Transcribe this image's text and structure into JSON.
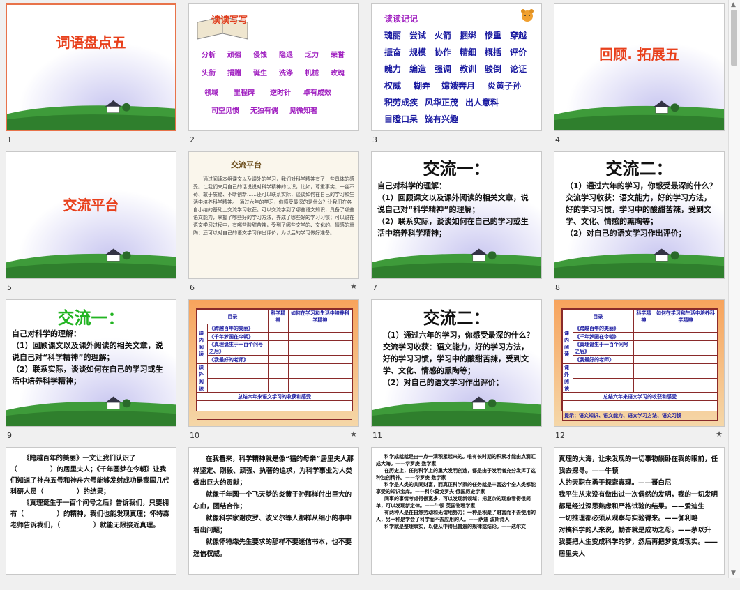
{
  "slides": [
    {
      "num": "1",
      "title": "词语盘点五"
    },
    {
      "num": "2",
      "header": "读读写写",
      "rows": [
        [
          "分析",
          "顽强",
          "侵蚀",
          "隐退",
          "乏力",
          "荣誉"
        ],
        [
          "头衔",
          "捐赠",
          "诞生",
          "洗涤",
          "机械",
          "玫瑰"
        ],
        [
          "领域",
          "里程碑",
          "逆时针",
          "卓有成效"
        ],
        [
          "司空见惯",
          "无独有偶",
          "见微知著"
        ]
      ]
    },
    {
      "num": "3",
      "header": "读读记记",
      "rows": [
        [
          "瑰丽",
          "尝试",
          "火箭",
          "捆绑",
          "惨重",
          "穿越"
        ],
        [
          "振奋",
          "规模",
          "协作",
          "精细",
          "概括",
          "评价"
        ],
        [
          "魄力",
          "编造",
          "强调",
          "教训",
          "骏倒",
          "论证"
        ],
        [
          "权威",
          "糊弄",
          "嫦娥奔月",
          "炎黄子孙"
        ],
        [
          "积劳成疾",
          "风华正茂",
          "出人意料"
        ],
        [
          "目瞪口呆",
          "饶有兴趣"
        ]
      ]
    },
    {
      "num": "4",
      "title": "回顾. 拓展五"
    },
    {
      "num": "5",
      "title": "交流平台"
    },
    {
      "num": "6",
      "header": "交流平台",
      "text": "通过阅读本组课文以及课外的学习，我们对科学精神有了一些具体的感受。让我们来用自己的话说说对科学精神的认识，比如，尊重事实、一丝不苟、敢于质疑、不断创新……还可以联系实际，谈谈如何在自己的学习和生活中培养科学精神。　通过六年的学习，你感受最深的是什么？让我们在各自小结的基础上交流学习收获。可以交流学到了哪些语文知识，具备了哪些语文能力，掌握了哪些好的学习方法，养成了哪些好的学习习惯；可以说在语文学习过程中，有哪些酸甜苦辣，受到了哪些文学的、文化的、情感的熏陶；还可以对自己的语文学习作出评价，为以后的学习做好准备。",
      "star": "★"
    },
    {
      "num": "7",
      "title": "交流一：",
      "lines": [
        "自己对科学的理解：",
        "（1）回顾课文以及课外阅读的相关文章，说说自己对“科学精神”的理解；",
        "（2）联系实际，谈谈如何在自己的学习或生活中培养科学精神；"
      ]
    },
    {
      "num": "8",
      "title": "交流二：",
      "lines": [
        "（1）通过六年的学习，你感受最深的什么？交流学习收获：语文能力，好的学习方法，好的学习习惯，学习中的酸甜苦辣，受到文学、文化、情感的熏陶等；",
        "（2）对自己的语文学习作出评价；"
      ]
    },
    {
      "num": "9",
      "title": "交流一：",
      "lines": [
        "自己对科学的理解：",
        "（1）回顾课文以及课外阅读的相关文章，说说自己对“科学精神”的理解；",
        "（2）联系实际，谈谈如何在自己的学习或生活中培养科学精神；"
      ]
    },
    {
      "num": "10",
      "star": "★",
      "table": {
        "h": [
          "目录",
          "科学精神",
          "如何在学习和生活中培养科学精神"
        ],
        "g1": "课内阅读",
        "r": [
          "《跨越百年的美丽》",
          "《千年梦圆在今朝》",
          "《真理诞生于一百个问号之后》",
          "《我最好的老师》"
        ],
        "g2": "课外阅读",
        "foot": "总结六年来语文学习的收获和感受"
      }
    },
    {
      "num": "11",
      "title": "交流二：",
      "lines": [
        "（1）通过六年的学习，你感受最深的什么？交流学习收获：语文能力，好的学习方法，好的学习习惯，学习中的酸甜苦辣，受到文学、文化、情感的熏陶等；",
        "（2）对自己的语文学习作出评价；"
      ]
    },
    {
      "num": "12",
      "star": "★",
      "table": {
        "h": [
          "目录",
          "科学精神",
          "如何在学习和生活中培养科学精神"
        ],
        "g1": "课内阅读",
        "r": [
          "《跨越百年的美丽》",
          "《千年梦圆在今朝》",
          "《真理诞生于一百个问号之后》",
          "《我最好的老师》"
        ],
        "g2": "课外阅读",
        "foot": "总结六年来语文学习的收获和感受"
      },
      "hint": "提示：语文知识、语文能力、语文学习方法、语文习惯"
    },
    {
      "num": "13",
      "lines": [
        "《跨越百年的美丽》一文让我们认识了（　　　　　）的居里夫人；《千年圆梦在今朝》让我们知道了神舟五号和神舟六号能够发射成功是我国几代科研人员（　　　　　）的结果；",
        "《真理诞生于一百个问号之后》告诉我们，只要拥有（　　　　　）的精神，我们也能发现真理；怀特森老师告诉我们，（　　　　　）就能无限接近真理。"
      ]
    },
    {
      "num": "14",
      "lines": [
        "在我看来，科学精神就是像“镭的母亲”居里夫人那样坚定、刚毅、顽强、执著的追求，为科学事业为人类做出巨大的贡献；",
        "就像千年圆一个飞天梦的炎黄子孙那样付出巨大的心血，团结合作；",
        "就像科学家谢皮罗、波义尔等人那样从细小的事中看出问题；",
        "就像怀特森先生要求的那样不要迷信书本，也不要迷信权威。"
      ]
    },
    {
      "num": "15",
      "lines": [
        "科学成就就是由一点一滴积累起来的。唯有长时期的积累才能由点滴汇成大海。——华罗庚 数学家",
        "在历史上，任何科学上的重大发明创造，都是由于发明者充分发挥了这种独创精神。——华罗庚 数学家",
        "科学是人类的共同财富，而真正科学家的任务就是丰富这个全人类都能享受的知识宝库。——科尔莫戈罗夫 俄国历史学家",
        "同事的事情考虑得很宽多，可以发现新领域；把复杂的现象看得很简单，可以发现新定律。——牛顿 英国物理学家",
        "有两种人是在自然劳动和无谓地努力：一种是积聚了财富而不去使用的人，另一种是学会了科学而不去应用的人。——萨迪 波斯诗人",
        "科学就是整理事实，以便从中得出普遍的规律或结论。——达尔文"
      ]
    },
    {
      "num": "16",
      "lines": [
        "真理的大海，让未发现的一切事物躺卧在我的眼前，任我去探寻。——牛顿",
        "人的天职在勇于探索真理。——哥白尼",
        "我平生从来没有做出过一次偶然的发明，我的一切发明都是经过深思熟虑和严格试验的结果。——爱迪生",
        "一切推理都必须从观察与实验得来。——伽利略",
        "对搞科学的人来说，勤奋就是成功之母。——茅以升",
        "我要把人生变成科学的梦，然后再把梦变成现实。——居里夫人"
      ]
    }
  ]
}
